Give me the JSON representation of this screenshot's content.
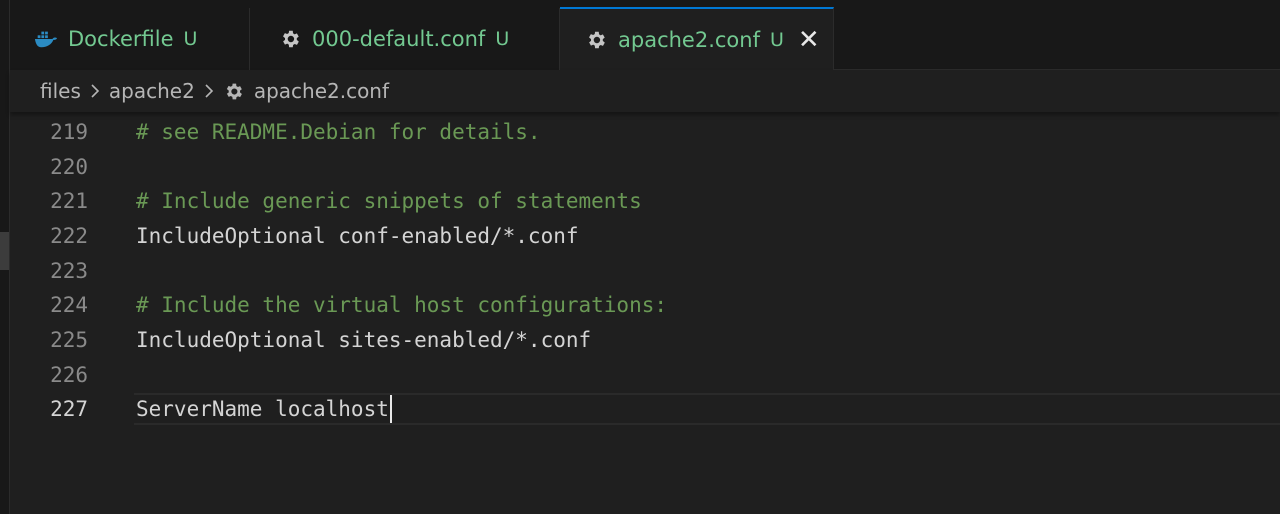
{
  "colors": {
    "untracked_green": "#73c991",
    "comment_green": "#6a9955",
    "text": "#d4d4d4",
    "active_tab_border": "#0078d4",
    "docker_blue": "#2b8bc2"
  },
  "tabs": [
    {
      "label": "Dockerfile",
      "badge": "U",
      "icon": "docker-whale-icon",
      "active": false
    },
    {
      "label": "000-default.conf",
      "badge": "U",
      "icon": "gear-icon",
      "active": false
    },
    {
      "label": "apache2.conf",
      "badge": "U",
      "icon": "gear-icon",
      "active": true,
      "close": "✕"
    }
  ],
  "breadcrumb": {
    "items": [
      "files",
      "apache2",
      "apache2.conf"
    ],
    "file_icon": "gear-icon"
  },
  "editor": {
    "current_line": "227",
    "lines": [
      {
        "num": "219",
        "text": "# see README.Debian for details.",
        "type": "comment"
      },
      {
        "num": "220",
        "text": "",
        "type": "plain"
      },
      {
        "num": "221",
        "text": "# Include generic snippets of statements",
        "type": "comment"
      },
      {
        "num": "222",
        "text": "IncludeOptional conf-enabled/*.conf",
        "type": "plain"
      },
      {
        "num": "223",
        "text": "",
        "type": "plain"
      },
      {
        "num": "224",
        "text": "# Include the virtual host configurations:",
        "type": "comment"
      },
      {
        "num": "225",
        "text": "IncludeOptional sites-enabled/*.conf",
        "type": "plain"
      },
      {
        "num": "226",
        "text": "",
        "type": "plain"
      },
      {
        "num": "227",
        "text": "ServerName localhost",
        "type": "plain"
      }
    ]
  }
}
